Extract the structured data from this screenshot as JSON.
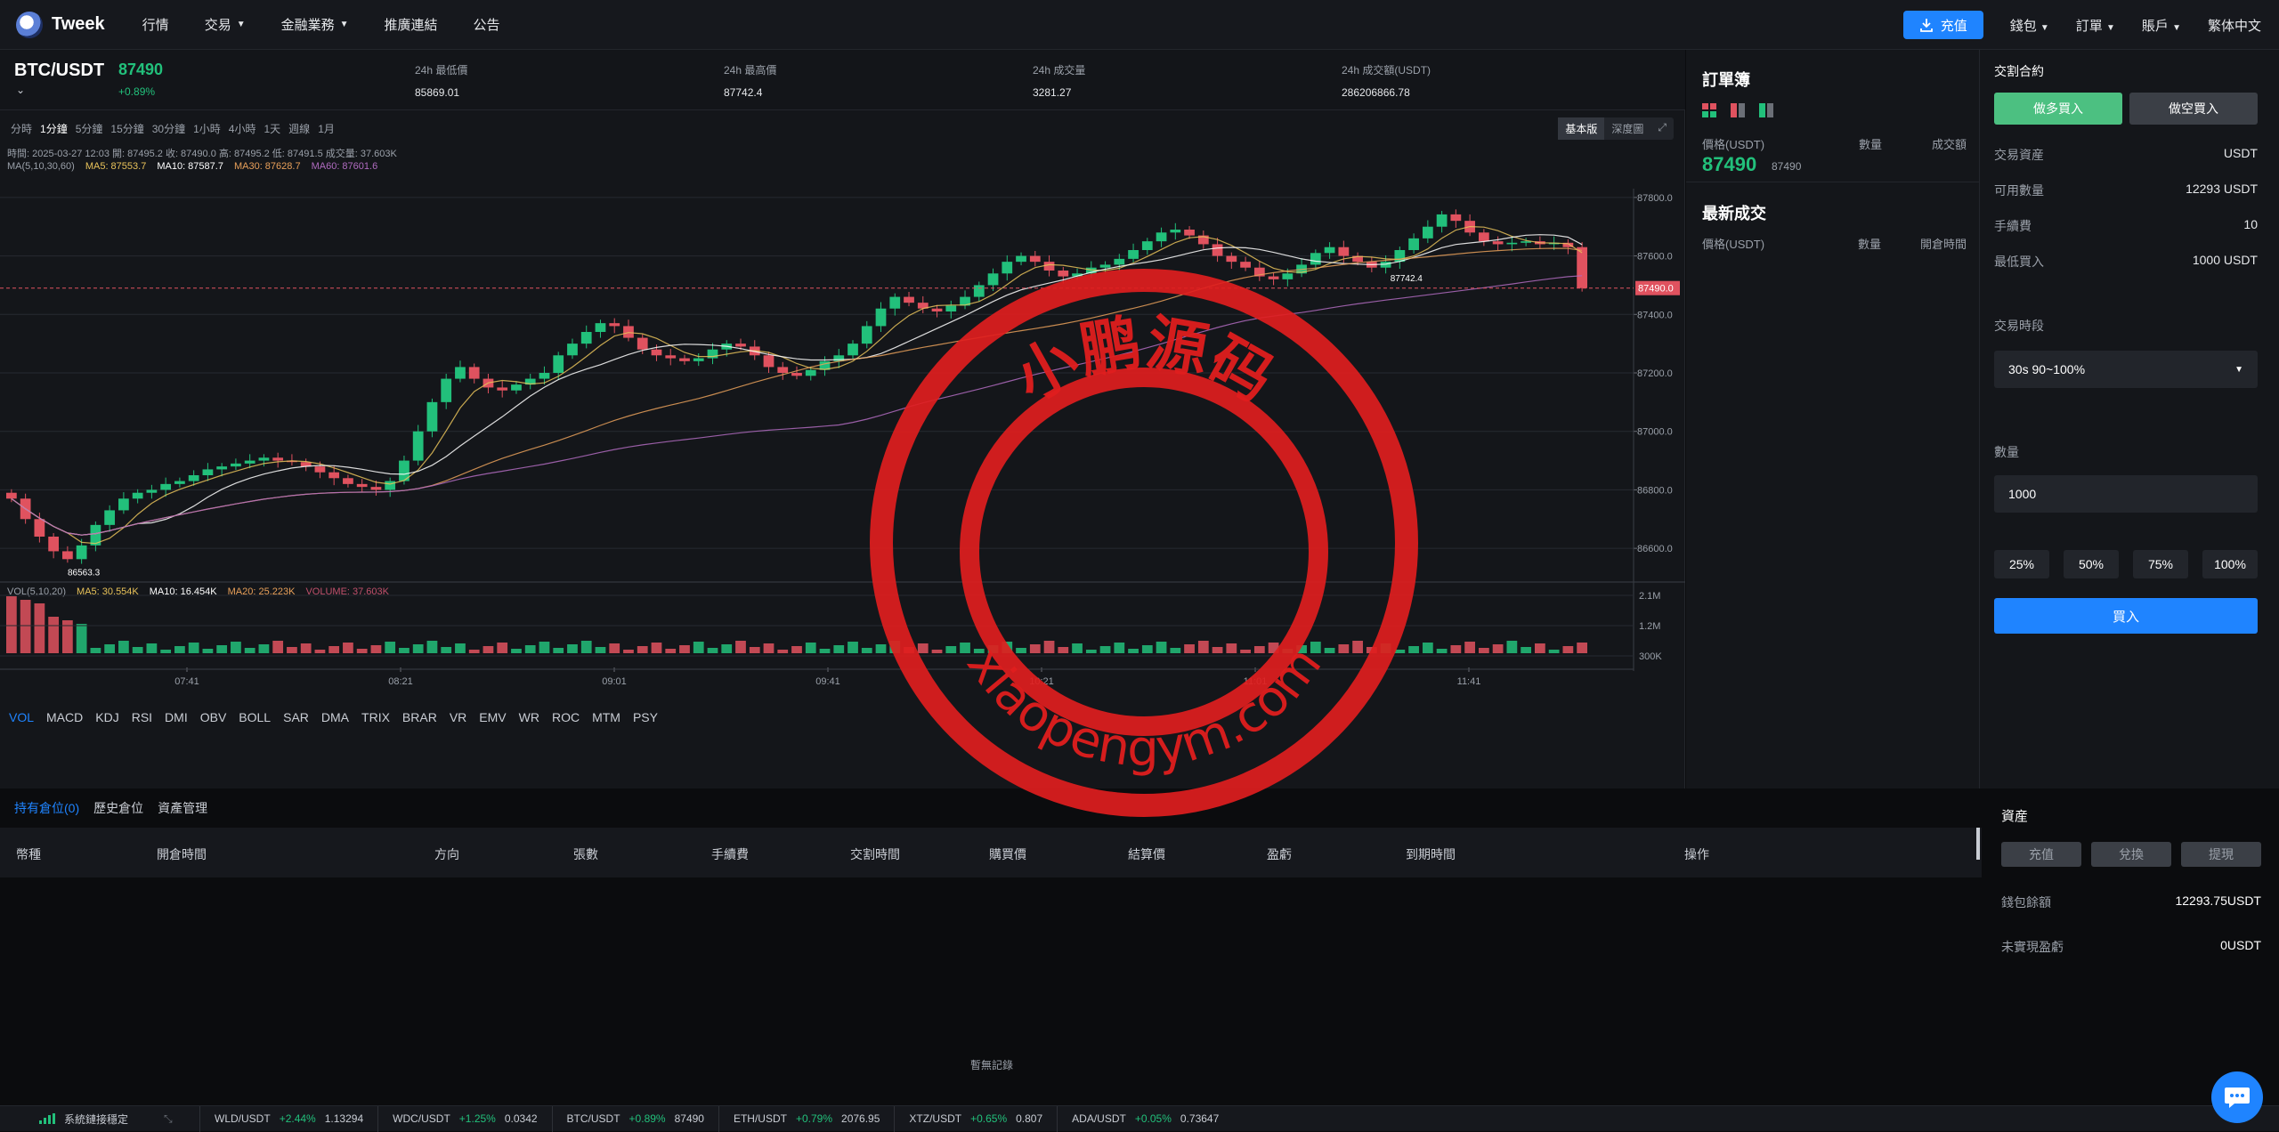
{
  "header": {
    "logo_text": "Tweek",
    "nav": [
      {
        "label": "行情",
        "caret": false
      },
      {
        "label": "交易",
        "caret": true
      },
      {
        "label": "金融業務",
        "caret": true
      },
      {
        "label": "推廣連結",
        "caret": false
      },
      {
        "label": "公告",
        "caret": false
      }
    ],
    "deposit_label": "充值",
    "right": [
      {
        "label": "錢包",
        "caret": true
      },
      {
        "label": "訂單",
        "caret": true
      },
      {
        "label": "賬戶",
        "caret": true
      },
      {
        "label": "繁体中文",
        "caret": false
      }
    ]
  },
  "ticker": {
    "pair": "BTC/USDT",
    "price": "87490",
    "change": "+0.89%",
    "stats": [
      {
        "label": "24h 最低價",
        "value": "85869.01"
      },
      {
        "label": "24h 最高價",
        "value": "87742.4"
      },
      {
        "label": "24h 成交量",
        "value": "3281.27"
      },
      {
        "label": "24h 成交額(USDT)",
        "value": "286206866.78"
      }
    ]
  },
  "chart": {
    "intervals": [
      "分時",
      "1分鐘",
      "5分鐘",
      "15分鐘",
      "30分鐘",
      "1小時",
      "4小時",
      "1天",
      "週線",
      "1月"
    ],
    "active_interval": "1分鐘",
    "view_modes": [
      "基本版",
      "深度圖"
    ],
    "ohlc_line": "時間: 2025-03-27 12:03    開: 87495.2    收: 87490.0    高: 87495.2    低: 87491.5    成交量: 37.603K",
    "ma_line": [
      {
        "text": "MA(5,10,30,60)",
        "color": "#9aa0a9"
      },
      {
        "text": "MA5: 87553.7",
        "color": "#e8c25a"
      },
      {
        "text": "MA10: 87587.7",
        "color": "#ffffff"
      },
      {
        "text": "MA30: 87628.7",
        "color": "#e8a05a"
      },
      {
        "text": "MA60: 87601.6",
        "color": "#b06bc0"
      }
    ],
    "vol_line": [
      {
        "text": "VOL(5,10,20)",
        "color": "#9aa0a9"
      },
      {
        "text": "MA5: 30.554K",
        "color": "#e8c25a"
      },
      {
        "text": "MA10: 16.454K",
        "color": "#ffffff"
      },
      {
        "text": "MA20: 25.223K",
        "color": "#e8a05a"
      },
      {
        "text": "VOLUME: 37.603K",
        "color": "#c0506b"
      }
    ],
    "indicators": [
      "VOL",
      "MACD",
      "KDJ",
      "RSI",
      "DMI",
      "OBV",
      "BOLL",
      "SAR",
      "DMA",
      "TRIX",
      "BRAR",
      "VR",
      "EMV",
      "WR",
      "ROC",
      "MTM",
      "PSY"
    ],
    "active_indicator": "VOL",
    "watermark_text": "小鹏源码",
    "watermark_url": "xiaopengym.com"
  },
  "chart_data": {
    "type": "candlestick",
    "x_ticks": [
      "07:41",
      "08:21",
      "09:01",
      "09:41",
      "10:21",
      "11:01",
      "11:41"
    ],
    "y_ticks": [
      87800.0,
      87600.0,
      87400.0,
      87200.0,
      87000.0,
      86800.0,
      86600.0
    ],
    "ylim": [
      86500,
      87830
    ],
    "last_price": 87490.0,
    "last_price_label": "87490.0",
    "high_marker": "87742.4",
    "low_marker": "86563.3",
    "series_close": [
      86770,
      86700,
      86640,
      86590,
      86563,
      86610,
      86680,
      86730,
      86770,
      86790,
      86800,
      86820,
      86830,
      86850,
      86870,
      86880,
      86890,
      86900,
      86910,
      86900,
      86895,
      86880,
      86860,
      86840,
      86820,
      86810,
      86800,
      86830,
      86900,
      87000,
      87100,
      87180,
      87220,
      87180,
      87150,
      87140,
      87160,
      87180,
      87200,
      87260,
      87300,
      87340,
      87370,
      87360,
      87320,
      87280,
      87260,
      87250,
      87240,
      87250,
      87280,
      87300,
      87290,
      87260,
      87220,
      87200,
      87190,
      87210,
      87240,
      87260,
      87300,
      87360,
      87420,
      87460,
      87440,
      87420,
      87410,
      87430,
      87460,
      87500,
      87540,
      87580,
      87600,
      87580,
      87550,
      87530,
      87540,
      87560,
      87570,
      87590,
      87620,
      87650,
      87680,
      87690,
      87670,
      87640,
      87600,
      87580,
      87560,
      87530,
      87520,
      87540,
      87570,
      87610,
      87630,
      87600,
      87580,
      87560,
      87580,
      87620,
      87660,
      87700,
      87742,
      87720,
      87680,
      87650,
      87640,
      87645,
      87650,
      87640,
      87645,
      87630,
      87490
    ],
    "vol_axis": [
      "2.1M",
      "1.2M",
      "300K"
    ]
  },
  "orderbook": {
    "title": "訂單簿",
    "header": [
      "價格(USDT)",
      "數量",
      "成交額"
    ],
    "price": "87490",
    "price_sub": "87490",
    "trades_title": "最新成交",
    "trades_header": [
      "價格(USDT)",
      "數量",
      "開倉時間"
    ]
  },
  "trade": {
    "title": "交割合約",
    "buy_long": "做多買入",
    "sell_short": "做空買入",
    "rows": [
      {
        "label": "交易資産",
        "value": "USDT"
      },
      {
        "label": "可用數量",
        "value": "12293 USDT"
      },
      {
        "label": "手續費",
        "value": "10"
      },
      {
        "label": "最低買入",
        "value": "1000 USDT"
      }
    ],
    "period_label": "交易時段",
    "period_value": "30s 90~100%",
    "qty_label": "數量",
    "qty_value": "1000",
    "percents": [
      "25%",
      "50%",
      "75%",
      "100%"
    ],
    "submit": "買入"
  },
  "positions": {
    "tabs": [
      "持有倉位(0)",
      "歷史倉位",
      "資產管理"
    ],
    "columns": [
      "幣種",
      "開倉時間",
      "方向",
      "張數",
      "手續費",
      "交割時間",
      "購買價",
      "結算價",
      "盈虧",
      "到期時間",
      "操作"
    ],
    "empty": "暫無記錄"
  },
  "assets": {
    "title": "資産",
    "buttons": [
      "充值",
      "兌換",
      "提現"
    ],
    "rows": [
      {
        "label": "錢包餘額",
        "value": "12293.75USDT"
      },
      {
        "label": "未實現盈虧",
        "value": "0USDT"
      }
    ]
  },
  "footer": {
    "status": "系統鏈接穩定",
    "tickers": [
      {
        "pair": "WLD/USDT",
        "chg": "+2.44%",
        "price": "1.13294"
      },
      {
        "pair": "WDC/USDT",
        "chg": "+1.25%",
        "price": "0.0342"
      },
      {
        "pair": "BTC/USDT",
        "chg": "+0.89%",
        "price": "87490"
      },
      {
        "pair": "ETH/USDT",
        "chg": "+0.79%",
        "price": "2076.95"
      },
      {
        "pair": "XTZ/USDT",
        "chg": "+0.65%",
        "price": "0.807"
      },
      {
        "pair": "ADA/USDT",
        "chg": "+0.05%",
        "price": "0.73647"
      }
    ]
  }
}
